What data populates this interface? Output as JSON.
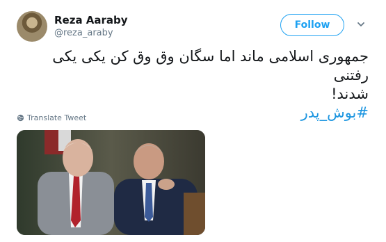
{
  "user": {
    "name": "Reza Aaraby",
    "handle": "@reza_araby"
  },
  "actions": {
    "follow_label": "Follow"
  },
  "tweet": {
    "line1": "جمهوری اسلامی ماند اما سگان وق وق کن یکی یکی رفتنی",
    "line2": "شدند!",
    "hashtag": "#بوش_پدر"
  },
  "translate_label": "Translate Tweet",
  "icons": {
    "avatar": "profile-photo",
    "chevron": "chevron-down-icon",
    "globe": "globe-icon"
  },
  "colors": {
    "accent": "#1da1f2",
    "hashtag": "#1b95e0",
    "muted": "#657786"
  }
}
